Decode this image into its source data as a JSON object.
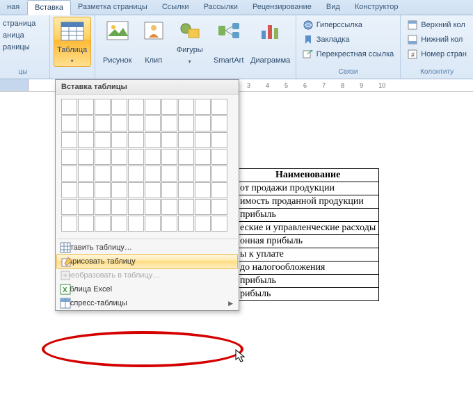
{
  "tabs": {
    "t0": "ная",
    "t1": "Вставка",
    "t2": "Разметка страницы",
    "t3": "Ссылки",
    "t4": "Рассылки",
    "t5": "Рецензирование",
    "t6": "Вид",
    "t7": "Конструктор"
  },
  "pages": {
    "p0": "страница",
    "p1": "аница",
    "p2": "раницы",
    "label": "цы"
  },
  "ribbon": {
    "table": {
      "label": "Таблица"
    },
    "picture": {
      "label": "Рисунок"
    },
    "clip": {
      "label": "Клип"
    },
    "shapes": {
      "label": "Фигуры"
    },
    "smartart": {
      "label": "SmartArt"
    },
    "chart": {
      "label": "Диаграмма"
    },
    "links": {
      "hyperlink": "Гиперссылка",
      "bookmark": "Закладка",
      "crossref": "Перекрестная ссылка",
      "group": "Связи"
    },
    "header": {
      "top": "Верхний кол",
      "bottom": "Нижний кол",
      "pagenum": "Номер стран",
      "group": "Колонтиту"
    }
  },
  "ruler": [
    "3",
    "4",
    "5",
    "6",
    "7",
    "8",
    "9",
    "10"
  ],
  "dropdown": {
    "header": "Вставка таблицы",
    "items": {
      "insert": "Вставить таблицу…",
      "draw_pre": "Н",
      "draw_rest": "арисовать таблицу",
      "convert": "Преобразовать в таблицу…",
      "excel_pre": "Т",
      "excel_rest": "аблица Excel",
      "express_pre": "Э",
      "express_rest": "кспресс-таблицы"
    }
  },
  "doc_table": {
    "header": "Наименование",
    "rows": [
      "от продажи продукции",
      "имость проданной  продукции",
      "прибыль",
      "еские и управленческие расходы",
      "онная прибыль",
      "ы к уплате",
      "до налогообложения",
      "прибыль",
      "рибыль"
    ]
  }
}
